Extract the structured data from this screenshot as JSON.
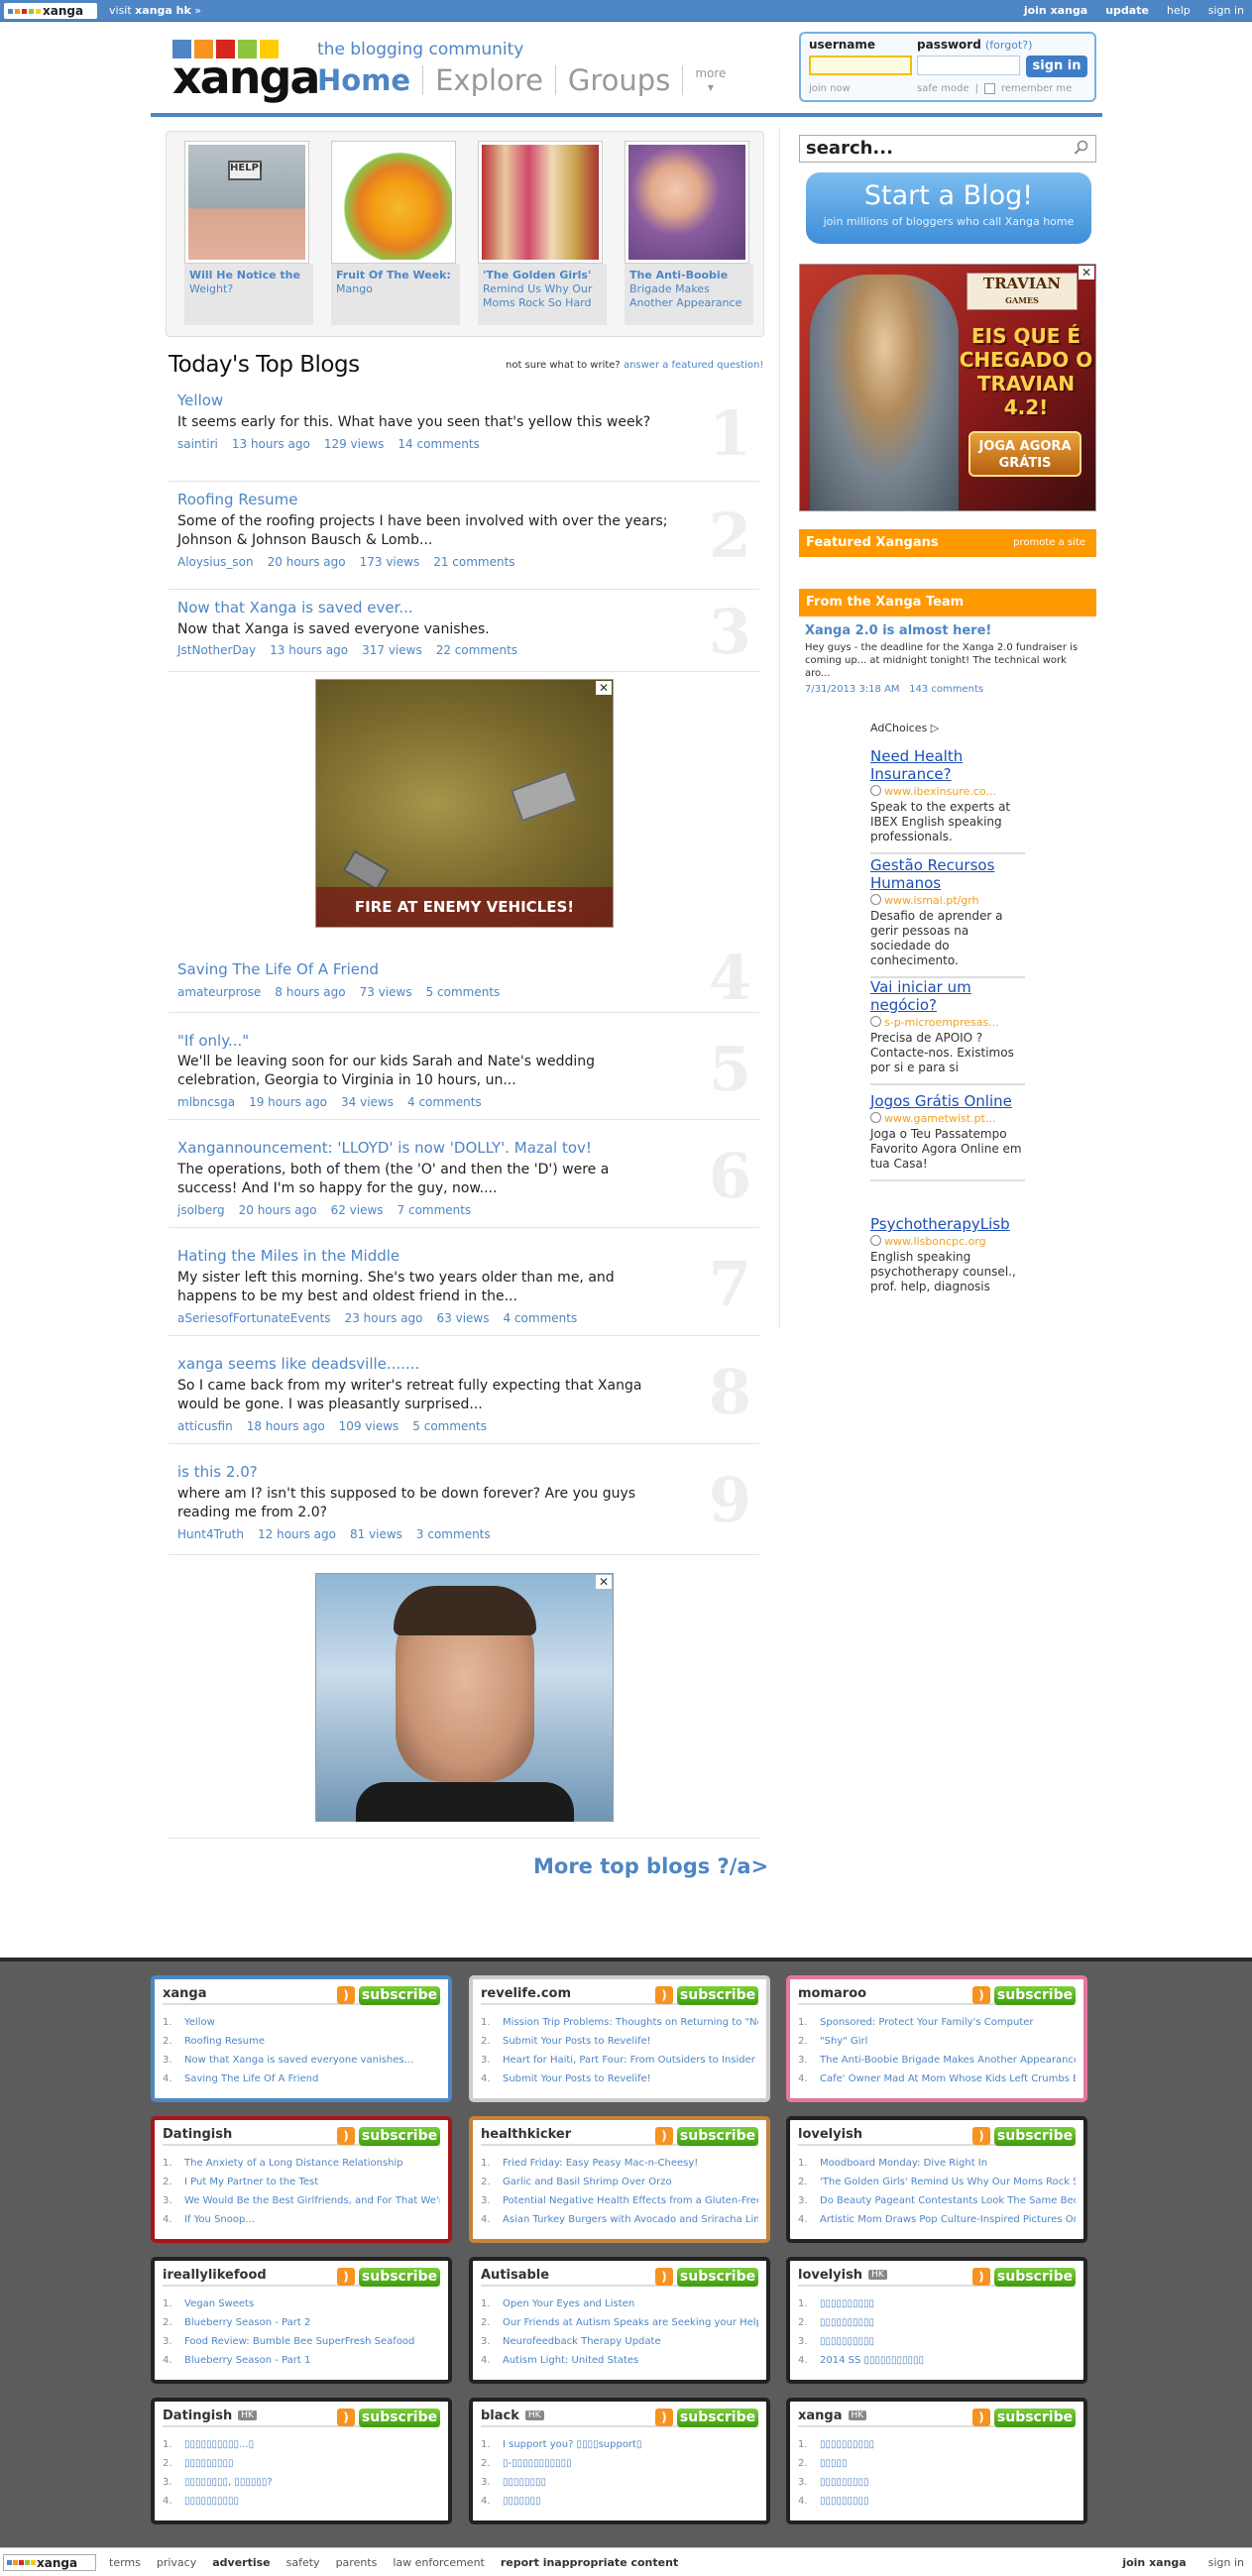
{
  "topbar": {
    "logo_text": "xanga",
    "visit_prefix": "visit",
    "visit_bold": "xanga hk",
    "visit_suffix": "»",
    "right_links": [
      "join xanga",
      "update",
      "help",
      "sign in"
    ]
  },
  "header": {
    "logo_text": "xanga",
    "tagline": "the blogging community",
    "nav": [
      "Home",
      "Explore",
      "Groups"
    ],
    "more_label": "more",
    "more_arrow": "▾"
  },
  "login": {
    "username_label": "username",
    "password_label": "password",
    "forgot_label": "(forgot?)",
    "signin_label": "sign in",
    "join_label": "join now",
    "safe_mode_label": "safe mode",
    "separator": "|",
    "remember_label": "remember me"
  },
  "featured": [
    {
      "title": "Will He Notice the",
      "subtitle": "Weight?",
      "icon": "bathroom-scale-photo"
    },
    {
      "title": "Fruit Of The Week:",
      "subtitle": "Mango",
      "icon": "mango-photo"
    },
    {
      "title": "'The Golden Girls'",
      "subtitle": "Remind Us Why Our Moms Rock So Hard",
      "icon": "golden-girls-photo"
    },
    {
      "title": "The Anti-Boobie",
      "subtitle": "Brigade Makes Another Appearance",
      "icon": "baby-photo"
    }
  ],
  "topblogs": {
    "title": "Today's Top Blogs",
    "not_sure": "not sure what to write?",
    "answer_link": "answer a featured question!",
    "items": [
      {
        "rank": "1",
        "title": "Yellow",
        "desc": "It seems early for this. What have you seen that's yellow this week?",
        "author": "saintiri",
        "time": "13 hours ago",
        "views": "129 views",
        "comments": "14 comments"
      },
      {
        "rank": "2",
        "title": "Roofing Resume",
        "desc": "Some of the roofing projects I have been involved with over the years; Johnson & Johnson Bausch & Lomb...",
        "author": "Aloysius_son",
        "time": "20 hours ago",
        "views": "173 views",
        "comments": "21 comments"
      },
      {
        "rank": "3",
        "title": "Now that Xanga is saved ever...",
        "desc": "Now that Xanga is saved everyone vanishes.",
        "author": "JstNotherDay",
        "time": "13 hours ago",
        "views": "317 views",
        "comments": "22 comments"
      },
      {
        "rank": "4",
        "title": "Saving The Life Of A Friend",
        "desc": "",
        "author": "amateurprose",
        "time": "8 hours ago",
        "views": "73 views",
        "comments": "5 comments"
      },
      {
        "rank": "5",
        "title": "\"If only...\"",
        "desc": "We'll be leaving soon for our kids Sarah and Nate's wedding celebration, Georgia to Virginia in 10 hours, un...",
        "author": "mlbncsga",
        "time": "19 hours ago",
        "views": "34 views",
        "comments": "4 comments"
      },
      {
        "rank": "6",
        "title": "Xangannouncement: 'LLOYD' is now 'DOLLY'. Mazal tov!",
        "desc": "The operations, both of them (the 'O' and then the 'D') were a success! And I'm so happy for the guy, now....",
        "author": "jsolberg",
        "time": "20 hours ago",
        "views": "62 views",
        "comments": "7 comments"
      },
      {
        "rank": "7",
        "title": "Hating the Miles in the Middle",
        "desc": "My sister left this morning. She's two years older than me, and happens to be my best and oldest friend in the...",
        "author": "aSeriesofFortunateEvents",
        "time": "23 hours ago",
        "views": "63 views",
        "comments": "4 comments"
      },
      {
        "rank": "8",
        "title": "xanga seems like deadsville.......",
        "desc": "So I came back from my writer's retreat fully expecting that Xanga would be gone. I was pleasantly surprised...",
        "author": "atticusfin",
        "time": "18 hours ago",
        "views": "109 views",
        "comments": "5 comments"
      },
      {
        "rank": "9",
        "title": "is this 2.0?",
        "desc": "where am I? isn't this supposed to be down forever? Are you guys reading me from 2.0?",
        "author": "Hunt4Truth",
        "time": "12 hours ago",
        "views": "81 views",
        "comments": "3 comments"
      }
    ],
    "more_link": "More top blogs ?/a>"
  },
  "ads": {
    "close": "✕",
    "game_caption": "FIRE AT ENEMY VEHICLES!",
    "travian_brand": "TRAVIAN",
    "travian_sub": "GAMES",
    "travian_headline": "EIS QUE É CHEGADO O TRAVIAN 4.2!",
    "travian_cta": "JOGA AGORA GRÁTIS"
  },
  "sidebar": {
    "search_placeholder": "search...",
    "start_title": "Start a Blog!",
    "start_sub": "join millions of bloggers who call Xanga home",
    "featured_xangans": "Featured Xangans",
    "promote": "promote a site",
    "from_team": "From the Xanga Team",
    "team_post_title": "Xanga 2.0 is almost here!",
    "team_post_text": "Hey guys - the deadline for the Xanga 2.0 fundraiser is coming up... at midnight tonight! The technical work aro...",
    "team_post_date": "7/31/2013 3:18 AM",
    "team_post_comments": "143 comments",
    "adchoices": "AdChoices ▷",
    "google_ads": [
      {
        "title": "Need Health Insurance?",
        "url": "www.ibexinsure.co...",
        "desc": "Speak to the experts at IBEX English speaking professionals."
      },
      {
        "title": "Gestão Recursos Humanos",
        "url": "www.ismai.pt/grh",
        "desc": "Desafio de aprender a gerir pessoas na sociedade do conhecimento."
      },
      {
        "title": "Vai iniciar um negócio?",
        "url": "s-p-microempresas...",
        "desc": "Precisa de APOIO ? Contacte-nos. Existimos por si e para si"
      },
      {
        "title": "Jogos Grátis Online",
        "url": "www.gametwist.pt...",
        "desc": "Joga o Teu Passatempo Favorito Agora Online em tua Casa!"
      },
      {
        "title": "PsychotherapyLisb",
        "url": "www.lisboncpc.org",
        "desc": "English speaking psychotherapy counsel., prof. help, diagnosis"
      }
    ]
  },
  "footer": {
    "subscribe": "subscribe",
    "rss": ")",
    "hk": "HK",
    "boxes": [
      {
        "brand": "xanga",
        "color": "#4e86c5",
        "items": [
          "Yellow",
          "Roofing Resume",
          "Now that Xanga is saved everyone vanishes...",
          "Saving The Life Of A Friend"
        ]
      },
      {
        "brand": "revelife.com",
        "color": "#cccccc",
        "items": [
          "Mission Trip Problems: Thoughts on Returning to \"No",
          "Submit Your Posts to Revelife!",
          "Heart for Haiti, Part Four: From Outsiders to Insider",
          "Submit Your Posts to Revelife!"
        ]
      },
      {
        "brand": "momaroo",
        "color": "#e3789f",
        "items": [
          "Sponsored: Protect Your Family's Computer",
          "\"Shy\" Girl",
          "The Anti-Boobie Brigade Makes Another Appearance",
          "Cafe' Owner Mad At Mom Whose Kids Left Crumbs B"
        ]
      },
      {
        "brand": "Datingish",
        "color": "#a4161a",
        "items": [
          "The Anxiety of a Long Distance Relationship",
          "I Put My Partner to the Test",
          "We Would Be the Best Girlfriends, and For That We'r",
          "If You Snoop..."
        ]
      },
      {
        "brand": "healthkicker",
        "color": "#c7833a",
        "items": [
          "Fried Friday: Easy Peasy Mac-n-Cheesy!",
          "Garlic and Basil Shrimp Over Orzo",
          "Potential Negative Health Effects from a Gluten-Free",
          "Asian Turkey Burgers with Avocado and Sriracha Lim"
        ]
      },
      {
        "brand": "lovelyish",
        "color": "#222222",
        "items": [
          "Moodboard Monday: Dive Right In",
          "'The Golden Girls' Remind Us Why Our Moms Rock So",
          "Do Beauty Pageant Contestants Look The Same Bec",
          "Artistic Mom Draws Pop Culture-Inspired Pictures On"
        ]
      },
      {
        "brand": "ireallylikefood",
        "color": "#222222",
        "items": [
          "Vegan Sweets",
          "Blueberry Season - Part 2",
          "Food Review: Bumble Bee SuperFresh Seafood",
          "Blueberry Season - Part 1"
        ]
      },
      {
        "brand": "Autisable",
        "color": "#222222",
        "items": [
          "Open Your Eyes and Listen",
          "Our Friends at Autism Speaks are Seeking your Help",
          "Neurofeedback Therapy Update",
          "Autism Light: United States"
        ]
      },
      {
        "brand": "lovelyish",
        "color": "#222222",
        "hk": true,
        "items": [
          "▯▯▯▯▯▯▯▯▯▯",
          "▯▯▯▯▯▯▯▯▯▯",
          "▯▯▯▯▯▯▯▯▯▯",
          "2014 SS ▯▯▯▯▯▯▯▯▯▯▯"
        ]
      },
      {
        "brand": "Datingish",
        "color": "#222222",
        "hk": true,
        "items": [
          "▯▯▯▯▯▯▯▯▯▯...▯",
          "▯▯▯▯▯▯▯▯▯",
          "▯▯▯▯▯▯▯▯, ▯▯▯▯▯▯?",
          "▯▯▯▯▯▯▯▯▯▯"
        ]
      },
      {
        "brand": "black",
        "color": "#222222",
        "hk": true,
        "items": [
          "I support you? ▯▯▯▯support▯",
          "▯-▯▯▯▯▯▯▯▯▯▯▯",
          "▯▯▯▯▯▯▯▯",
          "▯▯▯▯▯▯▯"
        ]
      },
      {
        "brand": "xanga",
        "color": "#222222",
        "hk": true,
        "items": [
          "▯▯▯▯▯▯▯▯▯▯",
          "▯▯▯▯▯",
          "▯▯▯▯▯▯▯▯▯",
          "▯▯▯▯▯▯▯▯▯"
        ]
      }
    ]
  },
  "bottombar": {
    "logo_text": "xanga",
    "links": [
      "terms",
      "privacy",
      "advertise",
      "safety",
      "parents",
      "law enforcement",
      "report inappropriate content"
    ],
    "right": [
      "join xanga",
      "sign in"
    ]
  },
  "colors": {
    "brand_blue": "#4e86c5",
    "orange": "#ff9900",
    "logo_squares": [
      "#4e86c5",
      "#f79321",
      "#d9261c",
      "#8cc63e",
      "#ffcc00"
    ]
  }
}
